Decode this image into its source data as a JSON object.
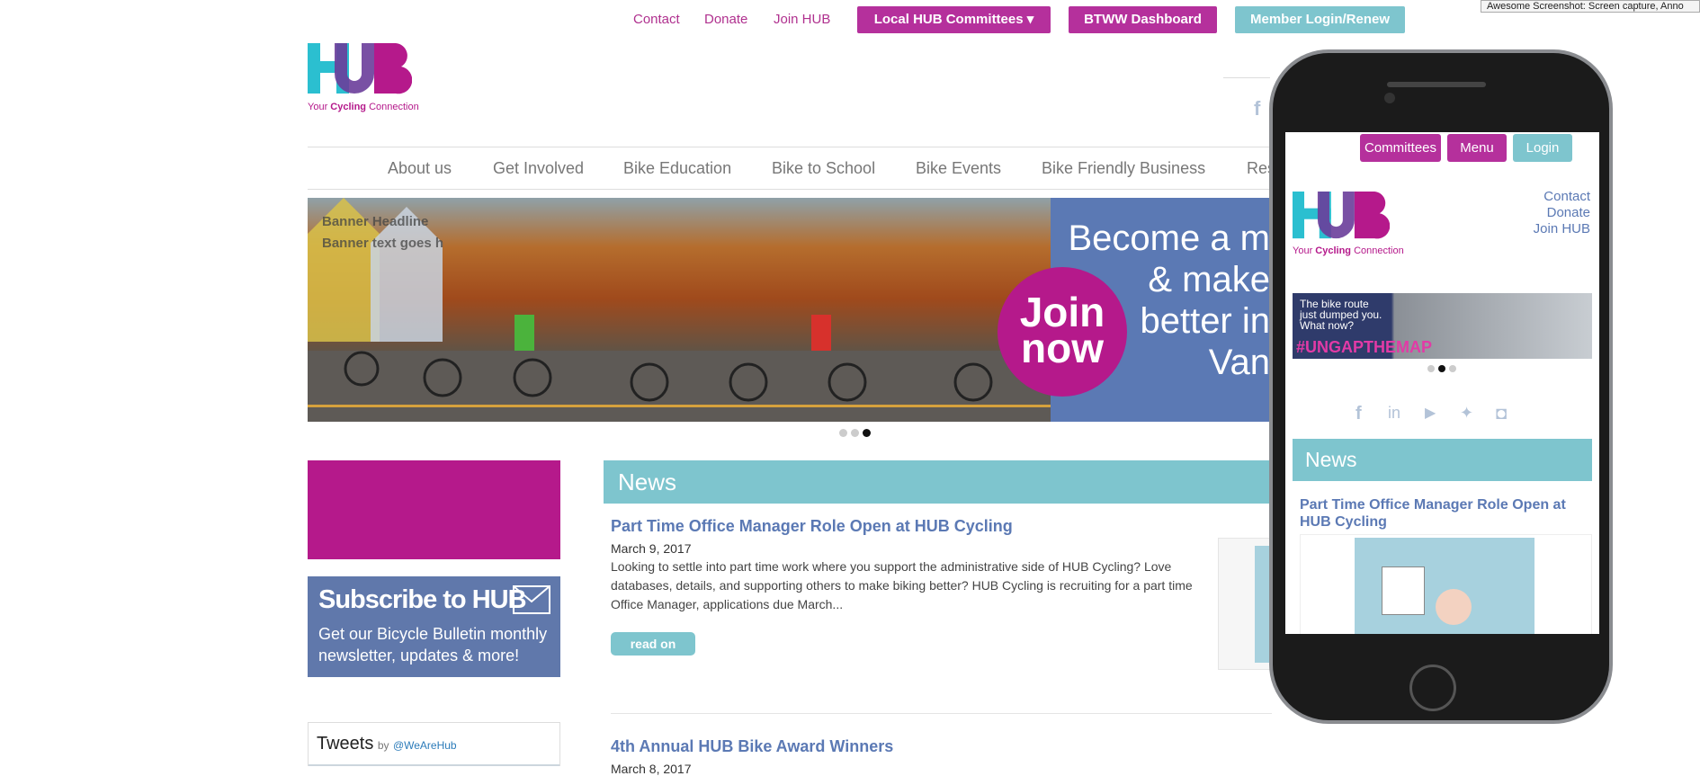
{
  "extension_tooltip": "Awesome Screenshot: Screen capture, Anno",
  "top_links": {
    "contact": "Contact",
    "donate": "Donate",
    "join": "Join HUB"
  },
  "top_buttons": {
    "committees": "Local HUB Committees ▾",
    "btww": "BTWW Dashboard",
    "login": "Member Login/Renew"
  },
  "logo": {
    "tagline_pre": "Your ",
    "tagline_bold": "Cycling",
    "tagline_post": " Connection"
  },
  "nav": [
    "About us",
    "Get Involved",
    "Bike Education",
    "Bike to School",
    "Bike Events",
    "Bike Friendly Business",
    "Res"
  ],
  "hero": {
    "banner_headline": "Banner Headline",
    "banner_text": "Banner text goes h",
    "join_line1": "Join",
    "join_line2": "now",
    "text_lines": [
      "Become a m",
      "& make",
      "better in",
      "Van"
    ],
    "active_dot": 3
  },
  "sidebar": {
    "subscribe_title": "Subscribe to HUB",
    "subscribe_text_1": "Get our Bicycle Bulletin monthly",
    "subscribe_text_2": "newsletter, updates & more!",
    "tweets_label": "Tweets",
    "tweets_by": "by",
    "tweets_handle": "@WeAreHub"
  },
  "news": {
    "heading": "News",
    "items": [
      {
        "title": "Part Time Office Manager Role Open at HUB Cycling",
        "date": "March 9, 2017",
        "excerpt": "Looking to settle into part time work where you support the administrative side of HUB Cycling? Love databases, details, and supporting others to make biking better? HUB Cycling is recruiting for a part time Office Manager, applications due March...",
        "read_more": "read on"
      },
      {
        "title": "4th Annual HUB Bike Award Winners",
        "date": "March 8, 2017"
      }
    ]
  },
  "phone": {
    "btn_committees": "Committees",
    "btn_menu": "Menu",
    "btn_login": "Login",
    "links": [
      "Contact",
      "Donate",
      "Join HUB"
    ],
    "banner_line1": "The bike route",
    "banner_line2": "just dumped you.",
    "banner_line3": "What now?",
    "banner_tag": "#UNGAPTHEMAP",
    "news_heading": "News",
    "news_title": "Part Time Office Manager Role Open at HUB Cycling"
  },
  "colors": {
    "magenta": "#b5198b",
    "blue": "#5b79b4",
    "teal": "#7ec5ce"
  }
}
